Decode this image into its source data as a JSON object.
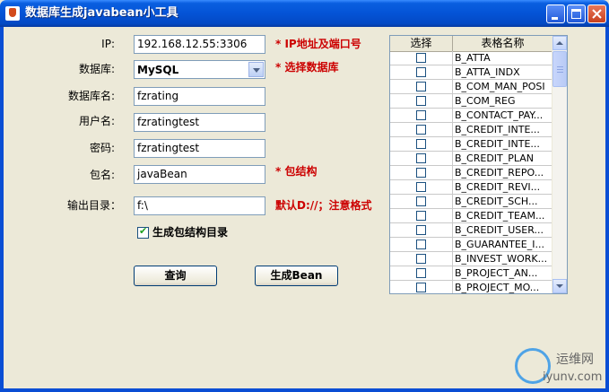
{
  "window": {
    "title": "数据库生成javabean小工具"
  },
  "form": {
    "ip_label": "IP:",
    "ip_value": "192.168.12.55:3306",
    "ip_hint": "* IP地址及端口号",
    "db_label": "数据库:",
    "db_value": "MySQL",
    "db_hint": "* 选择数据库",
    "dbname_label": "数据库名:",
    "dbname_value": "fzrating",
    "user_label": "用户名:",
    "user_value": "fzratingtest",
    "pwd_label": "密码:",
    "pwd_value": "fzratingtest",
    "pkg_label": "包名:",
    "pkg_value": "javaBean",
    "pkg_hint": "* 包结构",
    "out_label": "输出目录：",
    "out_value": "f:\\",
    "out_hint": "默认D://；注意格式",
    "gen_dir_label": "生成包结构目录",
    "gen_dir_checked": true
  },
  "buttons": {
    "query": "查询",
    "generate": "生成Bean"
  },
  "table": {
    "columns": [
      "选择",
      "表格名称"
    ],
    "rows": [
      {
        "checked": false,
        "name": "B_ATTA"
      },
      {
        "checked": false,
        "name": "B_ATTA_INDX"
      },
      {
        "checked": false,
        "name": "B_COM_MAN_POSI"
      },
      {
        "checked": false,
        "name": "B_COM_REG"
      },
      {
        "checked": false,
        "name": "B_CONTACT_PAY..."
      },
      {
        "checked": false,
        "name": "B_CREDIT_INTE..."
      },
      {
        "checked": false,
        "name": "B_CREDIT_INTE..."
      },
      {
        "checked": false,
        "name": "B_CREDIT_PLAN"
      },
      {
        "checked": false,
        "name": "B_CREDIT_REPO..."
      },
      {
        "checked": false,
        "name": "B_CREDIT_REVI..."
      },
      {
        "checked": false,
        "name": "B_CREDIT_SCH..."
      },
      {
        "checked": false,
        "name": "B_CREDIT_TEAM..."
      },
      {
        "checked": false,
        "name": "B_CREDIT_USER..."
      },
      {
        "checked": false,
        "name": "B_GUARANTEE_I..."
      },
      {
        "checked": false,
        "name": "B_INVEST_WORK..."
      },
      {
        "checked": false,
        "name": "B_PROJECT_AN..."
      },
      {
        "checked": false,
        "name": "B_PROJECT_MO..."
      }
    ]
  },
  "watermark": {
    "text": "运维网",
    "url": "iyunv.com"
  }
}
